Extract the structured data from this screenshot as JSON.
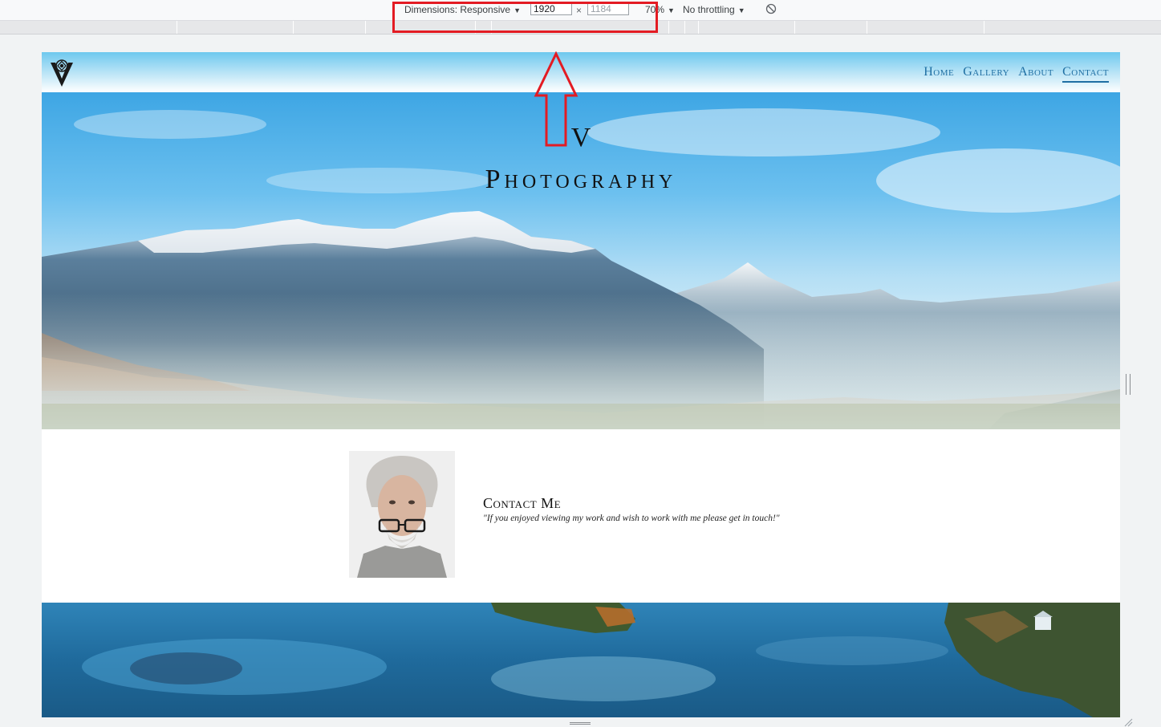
{
  "devtools": {
    "dimensions_label": "Dimensions: Responsive",
    "width_value": "1920",
    "height_placeholder": "1184",
    "times_symbol": "×",
    "zoom": "70%",
    "throttling": "No throttling"
  },
  "site": {
    "nav": {
      "home": "Home",
      "gallery": "Gallery",
      "about": "About",
      "contact": "Contact"
    },
    "hero": {
      "title_line1": "V",
      "title_line2": "Photography"
    },
    "contact": {
      "heading": "Contact Me",
      "quote": "\"If you enjoyed viewing my work and wish to work with me please get in touch!\""
    }
  },
  "colors": {
    "nav_link": "#1f6fa3",
    "annotation": "#e31b23"
  },
  "icons": {
    "logo": "v-logo-icon",
    "rotate": "rotate-icon",
    "annotation": "up-arrow-icon"
  }
}
